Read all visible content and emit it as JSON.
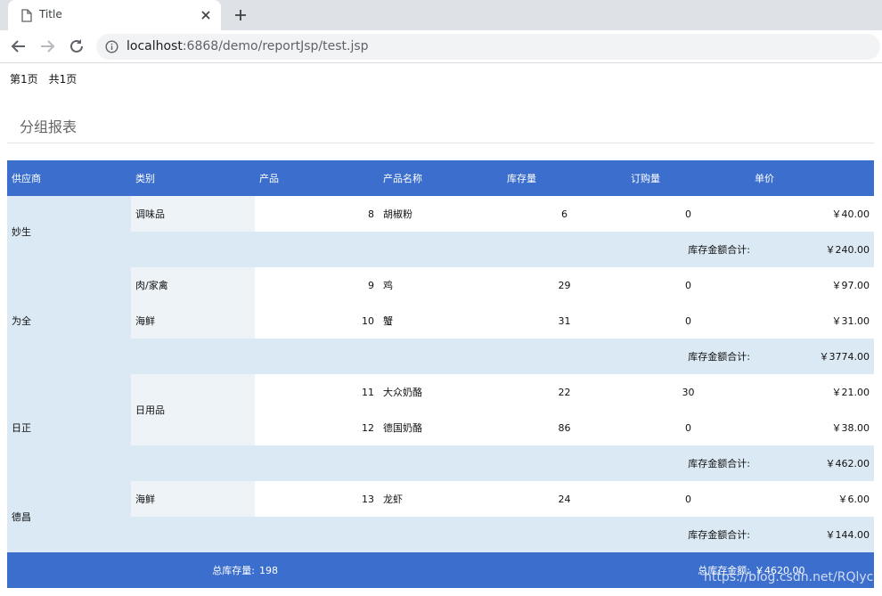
{
  "browser": {
    "tab_title": "Title",
    "url_host": "localhost",
    "url_rest": ":6868/demo/reportJsp/test.jsp",
    "icons": [
      "document-icon",
      "close-icon",
      "plus-icon",
      "back-icon",
      "forward-icon",
      "reload-icon",
      "info-icon"
    ]
  },
  "pager": {
    "current": "第1页",
    "total": "共1页"
  },
  "report": {
    "title": "分组报表",
    "headers": [
      "供应商",
      "类别",
      "产品",
      "产品名称",
      "库存量",
      "订购量",
      "单价"
    ],
    "groups": {
      "g1": {
        "supplier": "妙生",
        "categories": {
          "c1": {
            "name": "调味品"
          }
        },
        "rows": {
          "r1": {
            "id": "8",
            "name": "胡椒粉",
            "stock": "6",
            "order": "0",
            "price": "￥40.00"
          }
        },
        "subtotal_label": "库存金额合计:",
        "subtotal": "￥240.00"
      },
      "g2": {
        "supplier": "为全",
        "categories": {
          "c1": {
            "name": "肉/家禽"
          },
          "c2": {
            "name": "海鲜"
          }
        },
        "rows": {
          "r1": {
            "id": "9",
            "name": "鸡",
            "stock": "29",
            "order": "0",
            "price": "￥97.00"
          },
          "r2": {
            "id": "10",
            "name": "蟹",
            "stock": "31",
            "order": "0",
            "price": "￥31.00"
          }
        },
        "subtotal_label": "库存金额合计:",
        "subtotal": "￥3774.00"
      },
      "g3": {
        "supplier": "日正",
        "categories": {
          "c1": {
            "name": "日用品"
          }
        },
        "rows": {
          "r1": {
            "id": "11",
            "name": "大众奶酪",
            "stock": "22",
            "order": "30",
            "price": "￥21.00"
          },
          "r2": {
            "id": "12",
            "name": "德国奶酪",
            "stock": "86",
            "order": "0",
            "price": "￥38.00"
          }
        },
        "subtotal_label": "库存金额合计:",
        "subtotal": "￥462.00"
      },
      "g4": {
        "supplier": "德昌",
        "categories": {
          "c1": {
            "name": "海鲜"
          }
        },
        "rows": {
          "r1": {
            "id": "13",
            "name": "龙虾",
            "stock": "24",
            "order": "0",
            "price": "￥6.00"
          }
        },
        "subtotal_label": "库存金额合计:",
        "subtotal": "￥144.00"
      }
    },
    "footer": {
      "stock_label": "总库存量:",
      "stock_total": "198",
      "amount_label": "总库存金额:",
      "amount_total": "￥4620.00"
    }
  },
  "watermark": "https://blog.csdn.net/RQlyc"
}
